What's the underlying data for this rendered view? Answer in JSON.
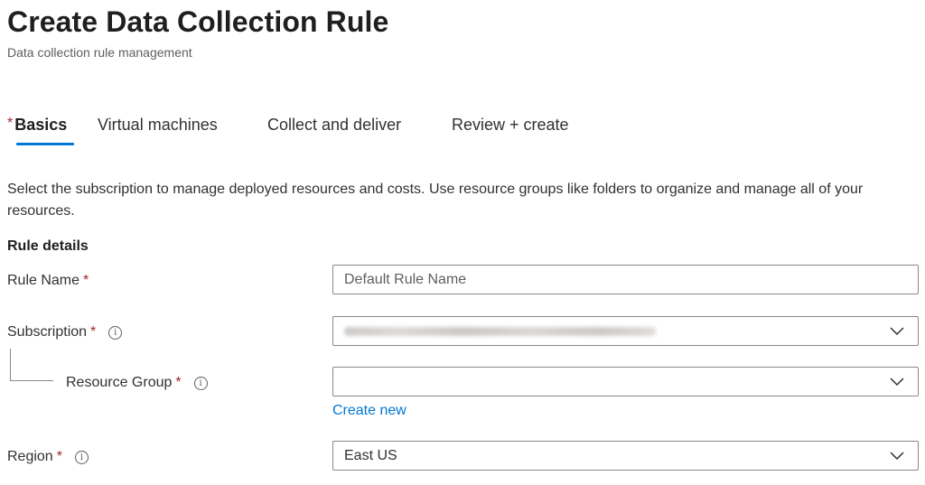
{
  "header": {
    "title": "Create Data Collection Rule",
    "subtitle": "Data collection rule management"
  },
  "tabs": [
    {
      "label": "Basics",
      "required_marker": "*",
      "active": true
    },
    {
      "label": "Virtual machines",
      "active": false
    },
    {
      "label": "Collect and deliver",
      "active": false
    },
    {
      "label": "Review + create",
      "active": false
    }
  ],
  "description": "Select the subscription to manage deployed resources and costs. Use resource groups like folders to organize and manage all of your resources.",
  "section": {
    "title": "Rule details"
  },
  "form": {
    "required_marker": "*",
    "info_glyph": "i",
    "rule_name": {
      "label": "Rule Name",
      "placeholder": "Default Rule Name",
      "value": ""
    },
    "subscription": {
      "label": "Subscription",
      "value_obscured": true
    },
    "resource_group": {
      "label": "Resource Group",
      "value": "",
      "create_new_label": "Create new"
    },
    "region": {
      "label": "Region",
      "value": "East US"
    }
  },
  "colors": {
    "accent": "#0078d4",
    "required": "#a4262c",
    "text": "#323130",
    "border": "#8a8886"
  },
  "icons": {
    "info": "info-circle-icon",
    "dropdown": "chevron-down-icon"
  }
}
